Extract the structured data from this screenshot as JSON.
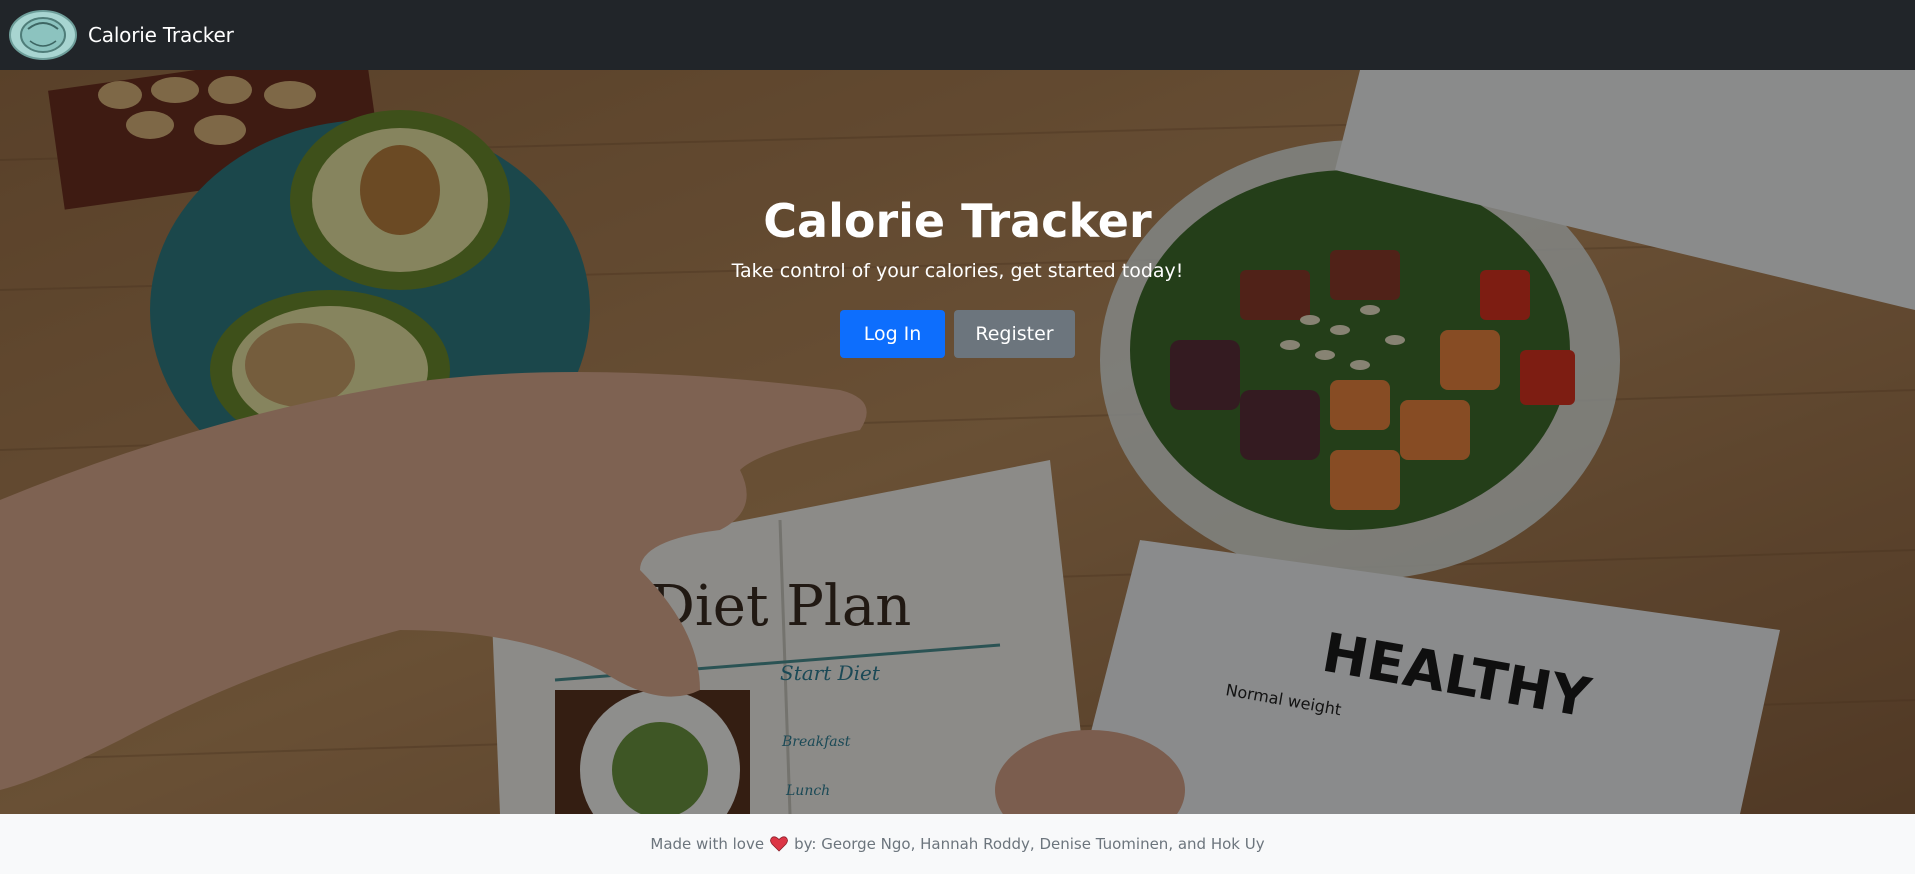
{
  "navbar": {
    "brand": "Calorie Tracker",
    "logo_icon": "plate-logo-icon"
  },
  "hero": {
    "title": "Calorie Tracker",
    "subtitle": "Take control of your calories, get started today!",
    "login_label": "Log In",
    "register_label": "Register",
    "background_image": "healthy-food-table-photo",
    "background_text": {
      "diet_plan": "Diet Plan",
      "start_diet": "Start Diet",
      "breakfast": "Breakfast",
      "lunch": "Lunch",
      "healthy": "HEALTHY",
      "normal_weight": "Normal weight"
    }
  },
  "footer": {
    "prefix": "Made with love",
    "heart_icon": "heart-icon",
    "suffix": "by: George Ngo, Hannah Roddy, Denise Tuominen, and Hok Uy"
  },
  "colors": {
    "navbar": "#212529",
    "primary": "#0d6efd",
    "secondary": "#6c757d",
    "footer_bg": "#f8f9fa",
    "footer_text": "#6c757d",
    "heart": "#dc3545"
  }
}
